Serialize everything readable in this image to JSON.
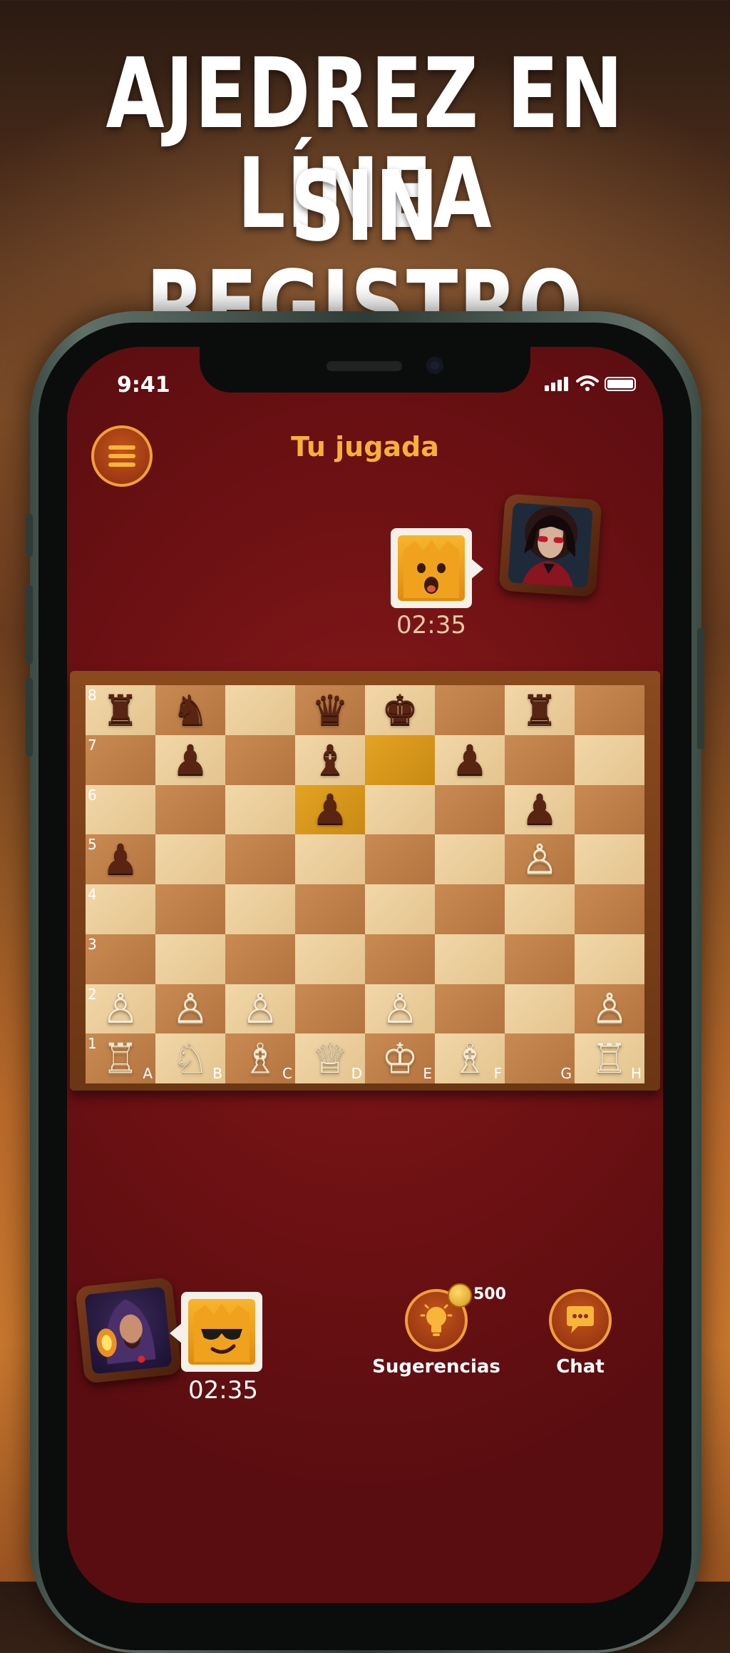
{
  "headline": {
    "line1": "AJEDREZ EN LÍNEA",
    "line2": "SIN REGISTRO"
  },
  "status_bar": {
    "time": "9:41"
  },
  "game": {
    "turn_title": "Tu jugada"
  },
  "opponent": {
    "timer": "02:35",
    "emoji": "surprised-crown-face"
  },
  "player": {
    "timer": "02:35",
    "emoji": "sunglasses-crown-face"
  },
  "board": {
    "ranks": [
      "8",
      "7",
      "6",
      "5",
      "4",
      "3",
      "2",
      "1"
    ],
    "files": [
      "A",
      "B",
      "C",
      "D",
      "E",
      "F",
      "G",
      "H"
    ],
    "rows": [
      [
        "♜",
        "♞",
        "",
        "♛",
        "♚",
        "",
        "♜",
        ""
      ],
      [
        "",
        "♟",
        "",
        "♝",
        "",
        "♟",
        "",
        ""
      ],
      [
        "",
        "",
        "",
        "♟",
        "",
        "",
        "♟",
        ""
      ],
      [
        "♟",
        "",
        "",
        "",
        "",
        "",
        "♙",
        ""
      ],
      [
        "",
        "",
        "",
        "",
        "",
        "",
        "",
        ""
      ],
      [
        "",
        "",
        "",
        "",
        "",
        "",
        "",
        ""
      ],
      [
        "♙",
        "♙",
        "♙",
        "",
        "♙",
        "",
        "",
        "♙"
      ],
      [
        "♖",
        "♘",
        "♗",
        "♕",
        "♔",
        "♗",
        "",
        "♖"
      ]
    ],
    "highlighted_squares": [
      "e7",
      "d6"
    ]
  },
  "controls": {
    "hints_label": "Sugerencias",
    "hints_coins": "500",
    "chat_label": "Chat"
  },
  "colors": {
    "accent": "#f5b13a",
    "background": "#6e1114"
  }
}
